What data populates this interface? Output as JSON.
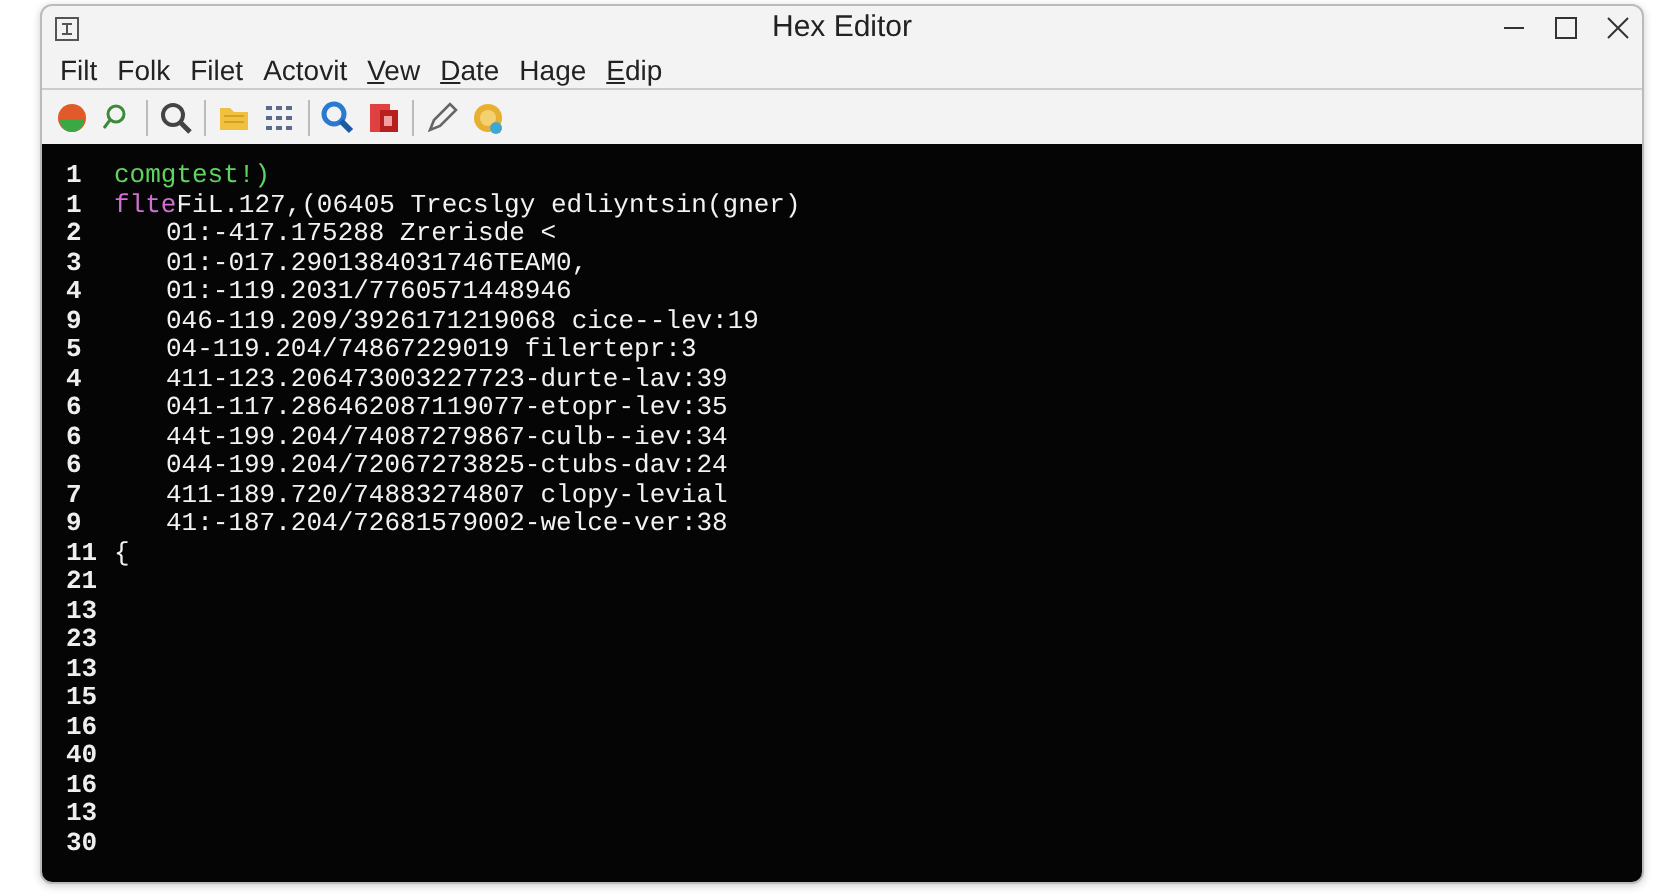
{
  "window": {
    "title": "Hex Editor"
  },
  "menu": [
    {
      "label": "Filt",
      "mnemonic": false
    },
    {
      "label": "Folk",
      "mnemonic": false
    },
    {
      "label": "Filet",
      "mnemonic": false
    },
    {
      "label": "Actovit",
      "mnemonic": false
    },
    {
      "label": "Vew",
      "mnemonic": true
    },
    {
      "label": "Date",
      "mnemonic": true
    },
    {
      "label": "Hage",
      "mnemonic": false
    },
    {
      "label": "Edip",
      "mnemonic": true
    }
  ],
  "toolbar": [
    {
      "kind": "globe"
    },
    {
      "kind": "small-search"
    },
    {
      "kind": "sep"
    },
    {
      "kind": "search"
    },
    {
      "kind": "sep"
    },
    {
      "kind": "folder"
    },
    {
      "kind": "grid"
    },
    {
      "kind": "sep"
    },
    {
      "kind": "blue-search"
    },
    {
      "kind": "document"
    },
    {
      "kind": "sep"
    },
    {
      "kind": "pen"
    },
    {
      "kind": "coin"
    }
  ],
  "lines": [
    {
      "number": "1",
      "indent": false,
      "segments": [
        {
          "text": "comgtest!)",
          "color": "#5fd35f"
        }
      ]
    },
    {
      "number": "1",
      "indent": false,
      "segments": [
        {
          "text": "flte",
          "color": "#d070d0"
        },
        {
          "text": "FiL.127,(06405 Trecslgy edliyntsin(gner)",
          "color": "#f2f2f2"
        }
      ]
    },
    {
      "number": "2",
      "indent": true,
      "segments": [
        {
          "text": "01:-417.175288 Zrerisde <",
          "color": "#f2f2f2"
        }
      ]
    },
    {
      "number": "3",
      "indent": true,
      "segments": [
        {
          "text": "01:-017.2901384031746TEAM0,",
          "color": "#f2f2f2"
        }
      ]
    },
    {
      "number": "4",
      "indent": true,
      "segments": [
        {
          "text": "01:-119.2031/7760571448946",
          "color": "#f2f2f2"
        }
      ]
    },
    {
      "number": "9",
      "indent": true,
      "segments": [
        {
          "text": "046-119.209/3926171219068 cice--lev:19",
          "color": "#f2f2f2"
        }
      ]
    },
    {
      "number": "5",
      "indent": true,
      "segments": [
        {
          "text": "04-119.204/74867229019 filertepr:3",
          "color": "#f2f2f2"
        }
      ]
    },
    {
      "number": "4",
      "indent": true,
      "segments": [
        {
          "text": "411-123.206473003227723-durte-lav:39",
          "color": "#f2f2f2"
        }
      ]
    },
    {
      "number": "6",
      "indent": true,
      "segments": [
        {
          "text": "041-117.286462087119077-etopr-lev:35",
          "color": "#f2f2f2"
        }
      ]
    },
    {
      "number": "6",
      "indent": true,
      "segments": [
        {
          "text": "44t-199.204/74087279867-culb--iev:34",
          "color": "#f2f2f2"
        }
      ]
    },
    {
      "number": "6",
      "indent": true,
      "segments": [
        {
          "text": "044-199.204/72067273825-ctubs-dav:24",
          "color": "#f2f2f2"
        }
      ]
    },
    {
      "number": "7",
      "indent": true,
      "segments": [
        {
          "text": "411-189.720/74883274807 clopy-levial",
          "color": "#f2f2f2"
        }
      ]
    },
    {
      "number": "9",
      "indent": true,
      "segments": [
        {
          "text": "41:-187.204/72681579002-welce-ver:38",
          "color": "#f2f2f2"
        }
      ]
    },
    {
      "number": "11",
      "indent": false,
      "segments": [
        {
          "text": "{",
          "color": "#f2f2f2"
        }
      ]
    },
    {
      "number": "21"
    },
    {
      "number": "13"
    },
    {
      "number": "23"
    },
    {
      "number": "13"
    },
    {
      "number": "15"
    },
    {
      "number": "16"
    },
    {
      "number": "40"
    },
    {
      "number": "16"
    },
    {
      "number": "13"
    },
    {
      "number": "30"
    }
  ]
}
